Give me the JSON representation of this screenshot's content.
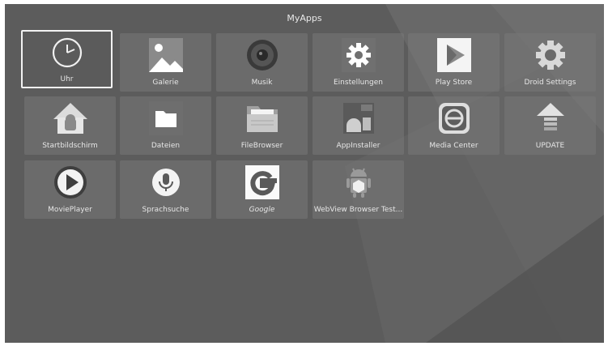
{
  "title": "MyApps",
  "apps": [
    {
      "label": "Uhr",
      "icon": "clock-icon",
      "selected": true
    },
    {
      "label": "Galerie",
      "icon": "gallery-icon"
    },
    {
      "label": "Musik",
      "icon": "speaker-icon"
    },
    {
      "label": "Einstellungen",
      "icon": "settings-gear-icon"
    },
    {
      "label": "Play Store",
      "icon": "play-store-icon"
    },
    {
      "label": "Droid Settings",
      "icon": "droid-settings-gear-icon"
    },
    {
      "label": "Startbildschirm",
      "icon": "android-home-icon"
    },
    {
      "label": "Dateien",
      "icon": "folder-icon"
    },
    {
      "label": "FileBrowser",
      "icon": "file-browser-folder-icon"
    },
    {
      "label": "AppInstaller",
      "icon": "app-installer-icon"
    },
    {
      "label": "Media Center",
      "icon": "media-center-icon"
    },
    {
      "label": "UPDATE",
      "icon": "update-arrow-icon"
    },
    {
      "label": "MoviePlayer",
      "icon": "movie-player-icon"
    },
    {
      "label": "Sprachsuche",
      "icon": "microphone-icon"
    },
    {
      "label": "Google",
      "icon": "google-g-icon"
    },
    {
      "label": "WebView Browser Test...",
      "icon": "android-robot-icon"
    }
  ]
}
